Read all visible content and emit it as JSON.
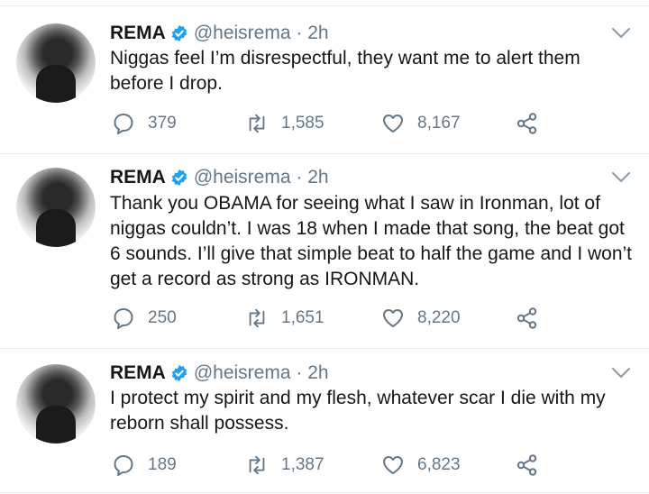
{
  "tweets": [
    {
      "name": "REMA",
      "handle": "@heisrema · 2h",
      "text": "Niggas feel I’m disrespectful, they want me to alert them before I drop.",
      "replies": "379",
      "retweets": "1,585",
      "likes": "8,167"
    },
    {
      "name": "REMA",
      "handle": "@heisrema · 2h",
      "text": "Thank you OBAMA for seeing what I saw in Ironman, lot of niggas couldn’t. I was 18 when I made that song, the beat got 6 sounds. I’ll give that simple beat to half the game and I won’t get a record as strong as IRONMAN.",
      "replies": "250",
      "retweets": "1,651",
      "likes": "8,220"
    },
    {
      "name": "REMA",
      "handle": "@heisrema · 2h",
      "text": "I protect my spirit and my flesh, whatever scar I die with my reborn shall possess.",
      "replies": "189",
      "retweets": "1,387",
      "likes": "6,823"
    }
  ],
  "colors": {
    "verified": "#1da1f2",
    "secondary_text": "#657786",
    "divider": "#e6ecf0"
  },
  "icons": [
    "verified-badge-icon",
    "chevron-down-icon",
    "reply-icon",
    "retweet-icon",
    "like-icon",
    "share-icon"
  ]
}
